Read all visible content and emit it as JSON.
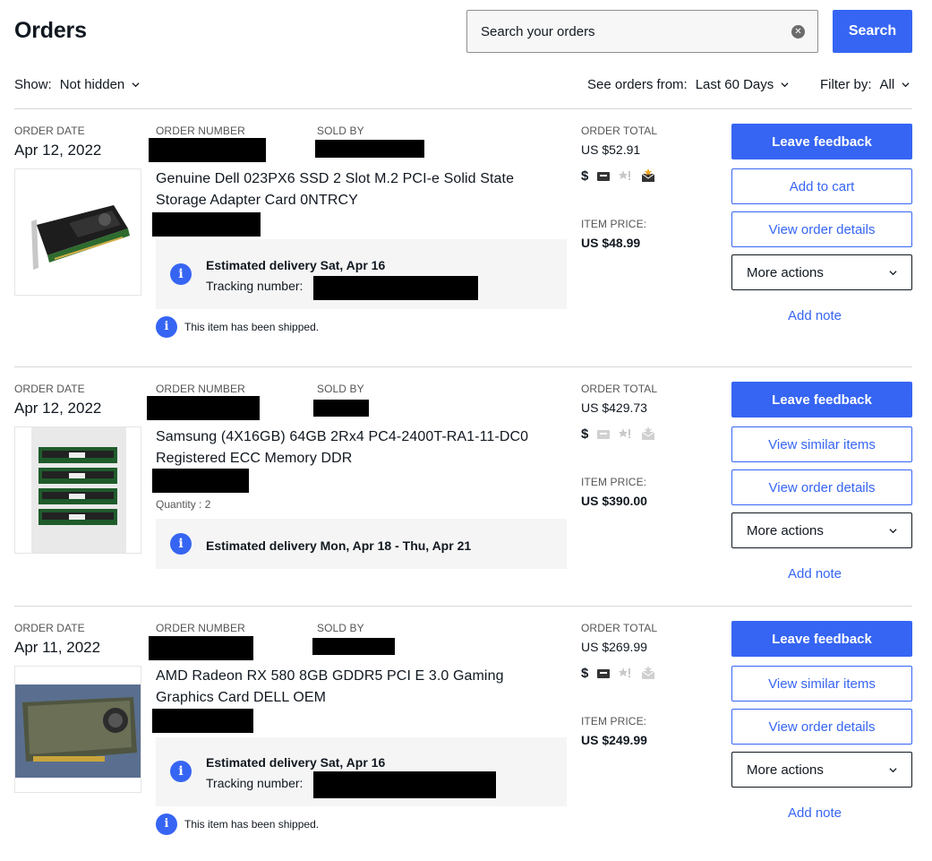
{
  "header": {
    "title": "Orders",
    "search_placeholder": "Search your orders",
    "search_button": "Search"
  },
  "filters": {
    "show_label": "Show:",
    "show_value": "Not hidden",
    "orders_from_label": "See orders from:",
    "orders_from_value": "Last 60 Days",
    "filter_label": "Filter by:",
    "filter_value": "All"
  },
  "labels": {
    "order_date": "ORDER DATE",
    "order_number": "ORDER NUMBER",
    "sold_by": "SOLD BY",
    "order_total": "ORDER TOTAL",
    "item_price": "ITEM PRICE:",
    "tracking": "Tracking number:",
    "shipped": "This item has been shipped.",
    "more_actions": "More actions",
    "add_note": "Add note",
    "leave_feedback": "Leave feedback",
    "view_order_details": "View order details"
  },
  "orders": [
    {
      "date": "Apr 12, 2022",
      "title": "Genuine Dell 023PX6 SSD 2 Slot M.2 PCI-e Solid State Storage Adapter Card 0NTRCY",
      "delivery": "Estimated delivery Sat, Apr 16",
      "total": "US $52.91",
      "item_price": "US $48.99",
      "secondary_action": "Add to cart",
      "dollar": "$"
    },
    {
      "date": "Apr 12, 2022",
      "title": "Samsung (4X16GB) 64GB 2Rx4 PC4-2400T-RA1-11-DC0 Registered ECC Memory DDR",
      "quantity": "Quantity : 2",
      "delivery": "Estimated delivery Mon, Apr 18 - Thu, Apr 21",
      "total": "US $429.73",
      "item_price": "US $390.00",
      "secondary_action": "View similar items",
      "dollar": "$"
    },
    {
      "date": "Apr 11, 2022",
      "title": "AMD Radeon RX 580 8GB GDDR5 PCI E 3.0 Gaming Graphics Card DELL OEM",
      "delivery": "Estimated delivery Sat, Apr 16",
      "total": "US $269.99",
      "item_price": "US $249.99",
      "secondary_action": "View similar items",
      "dollar": "$"
    }
  ],
  "colors": {
    "accent": "#3665f3",
    "text": "#111820",
    "muted": "#555555",
    "panel": "#f5f5f5"
  }
}
